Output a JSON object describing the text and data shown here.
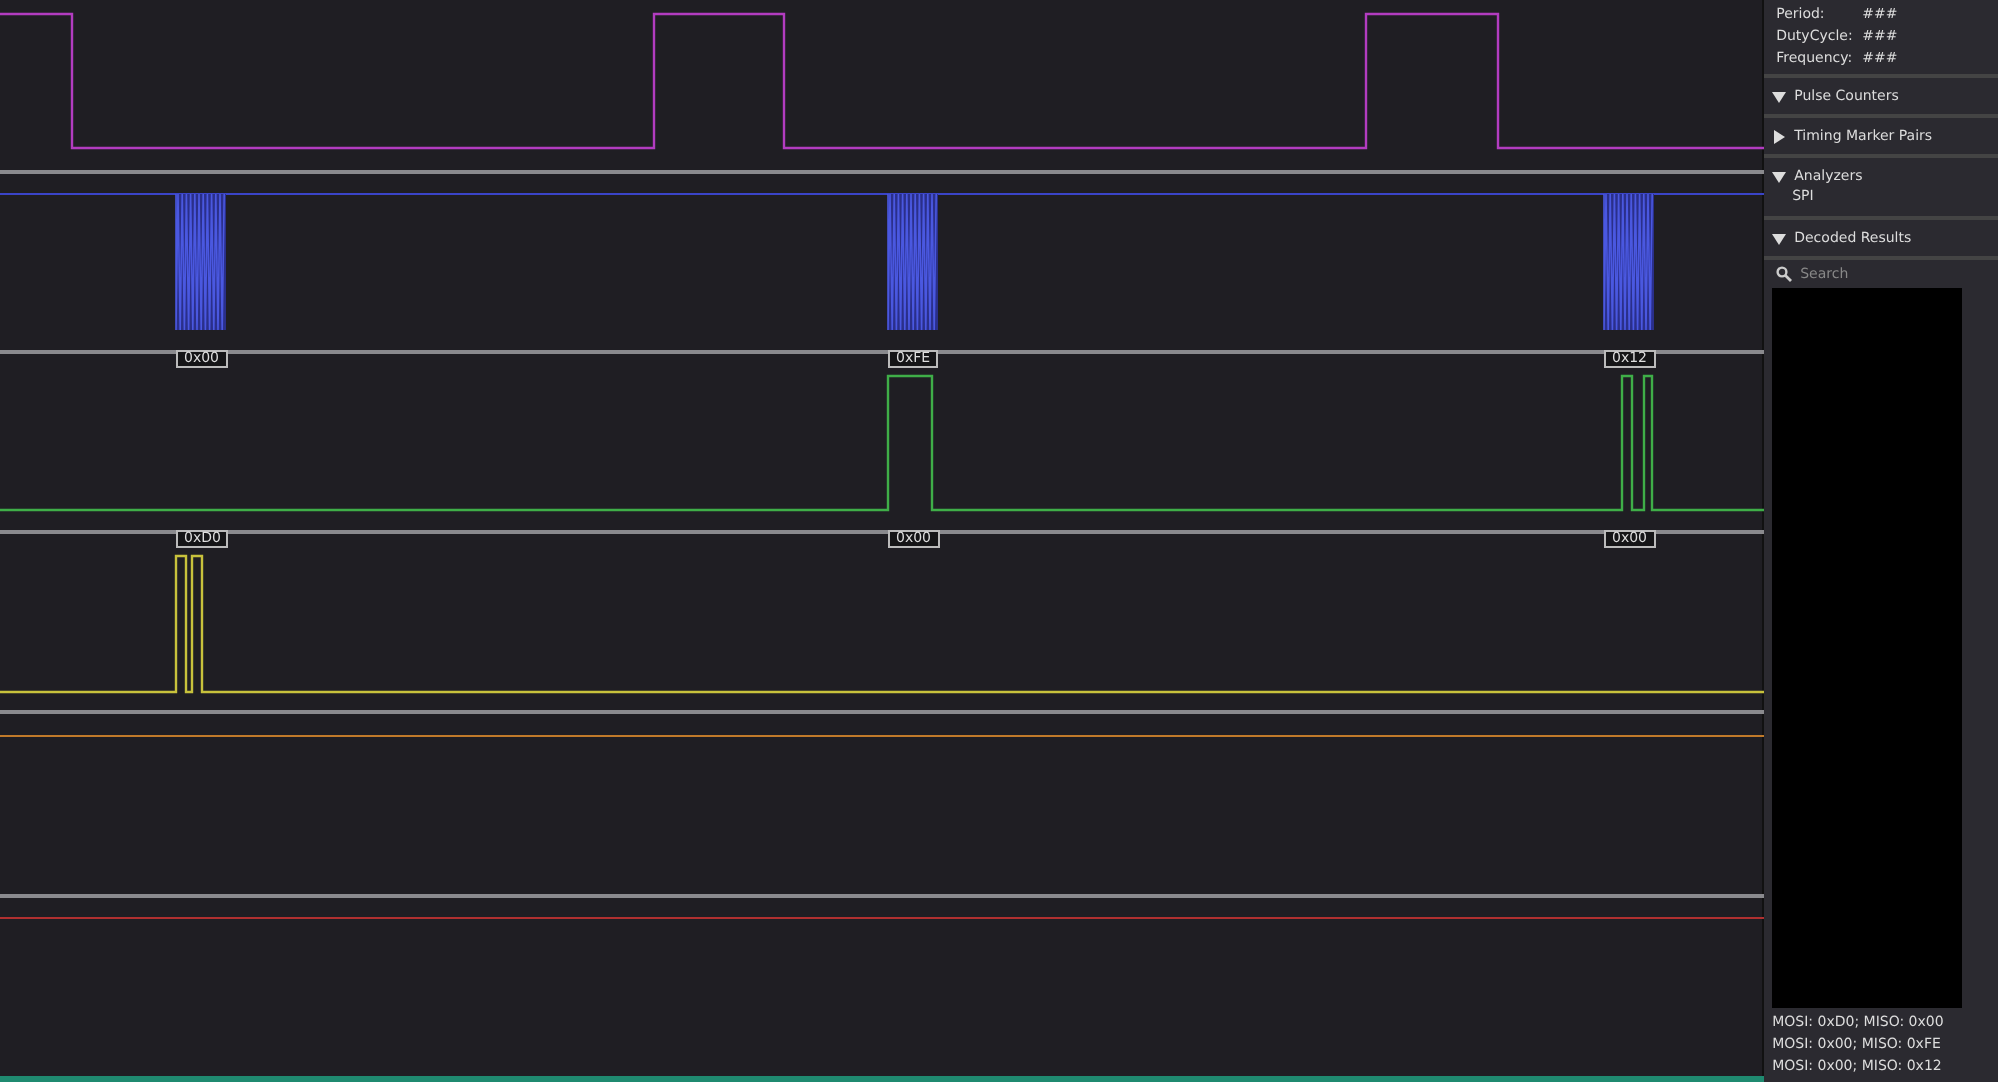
{
  "measurements": [
    {
      "label": "Period:",
      "value": "###"
    },
    {
      "label": "DutyCycle:",
      "value": "###"
    },
    {
      "label": "Frequency:",
      "value": "###"
    }
  ],
  "sections": [
    {
      "title": "Pulse Counters",
      "expanded": true
    },
    {
      "title": "Timing Marker Pairs",
      "expanded": false
    },
    {
      "title": "Analyzers",
      "expanded": true,
      "children": [
        "SPI"
      ]
    },
    {
      "title": "Decoded Results",
      "expanded": true
    }
  ],
  "search": {
    "placeholder": "Search"
  },
  "decoded_results": [
    "MOSI: 0xD0;  MISO: 0x00",
    "MOSI: 0x00;  MISO: 0xFE",
    "MOSI: 0x00;  MISO: 0x12"
  ],
  "bubbles": [
    {
      "labels": [
        "0x00",
        "0xFE",
        "0x12"
      ]
    },
    {
      "labels": [
        "0xD0",
        "0x00",
        "0x00"
      ]
    }
  ]
}
